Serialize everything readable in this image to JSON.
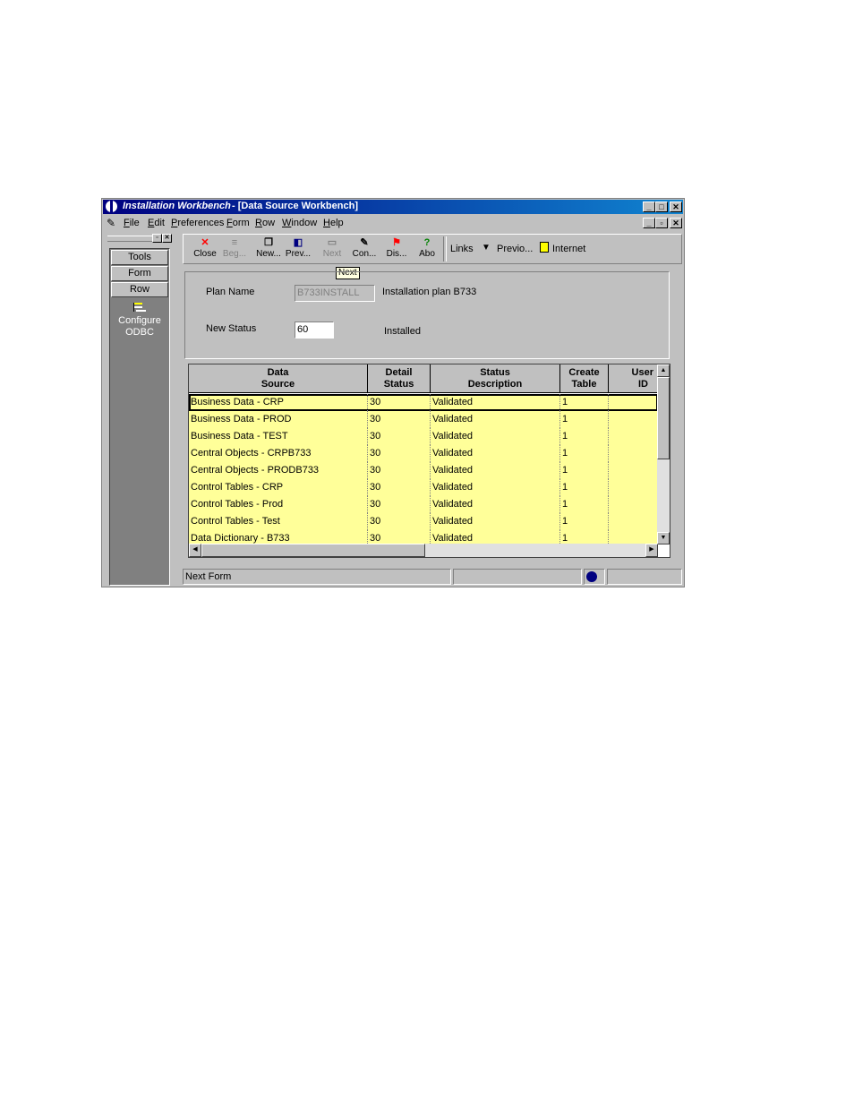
{
  "window": {
    "title_app": "Installation Workbench",
    "title_rest": " - [Data Source Workbench]",
    "controls": {
      "minimize": "_",
      "maximize": "□",
      "close": "✕",
      "restore": "▫"
    }
  },
  "menu": {
    "items": [
      "File",
      "Edit",
      "Preferences",
      "Form",
      "Row",
      "Window",
      "Help"
    ]
  },
  "sidebar": {
    "buttons": [
      "Tools",
      "Form",
      "Row"
    ],
    "exit_label_line1": "Configure",
    "exit_label_line2": "ODBC"
  },
  "toolbar": {
    "buttons": [
      {
        "label": "Close",
        "icon": "close-icon",
        "glyph": "✕",
        "color": "#ff0000",
        "enabled": true
      },
      {
        "label": "Beg...",
        "icon": "begin-icon",
        "glyph": "≡",
        "color": "#808080",
        "enabled": false
      },
      {
        "label": "New...",
        "icon": "new-icon",
        "glyph": "❐",
        "color": "#000000",
        "enabled": true
      },
      {
        "label": "Prev...",
        "icon": "previous-icon",
        "glyph": "◧",
        "color": "#000080",
        "enabled": true
      },
      {
        "label": "Next",
        "icon": "next-icon",
        "glyph": "▭",
        "color": "#808080",
        "enabled": false
      },
      {
        "label": "Con...",
        "icon": "connect-icon",
        "glyph": "✎",
        "color": "#000000",
        "enabled": true
      },
      {
        "label": "Dis...",
        "icon": "display-icon",
        "glyph": "⚑",
        "color": "#ff0000",
        "enabled": true
      },
      {
        "label": "Abo",
        "icon": "about-icon",
        "glyph": "?",
        "color": "#008000",
        "enabled": true
      }
    ],
    "links_label": "Links",
    "previous_label": "Previo...",
    "internet_label": "Internet",
    "tooltip": "Next"
  },
  "form": {
    "plan_name_label": "Plan Name",
    "plan_name_value": "B733INSTALL",
    "plan_description": "Installation plan B733",
    "new_status_label": "New Status",
    "new_status_value": "60",
    "new_status_description": "Installed"
  },
  "grid": {
    "columns": [
      {
        "line1": "Data",
        "line2": "Source"
      },
      {
        "line1": "Detail",
        "line2": "Status"
      },
      {
        "line1": "Status",
        "line2": "Description"
      },
      {
        "line1": "Create",
        "line2": "Table"
      },
      {
        "line1": "User",
        "line2": "ID"
      }
    ],
    "rows": [
      [
        "Business Data - CRP",
        "30",
        "Validated",
        "1",
        ""
      ],
      [
        "Business Data - PROD",
        "30",
        "Validated",
        "1",
        ""
      ],
      [
        "Business Data - TEST",
        "30",
        "Validated",
        "1",
        ""
      ],
      [
        "Central Objects - CRPB733",
        "30",
        "Validated",
        "1",
        ""
      ],
      [
        "Central Objects - PRODB733",
        "30",
        "Validated",
        "1",
        ""
      ],
      [
        "Control Tables - CRP",
        "30",
        "Validated",
        "1",
        ""
      ],
      [
        "Control Tables - Prod",
        "30",
        "Validated",
        "1",
        ""
      ],
      [
        "Control Tables - Test",
        "30",
        "Validated",
        "1",
        ""
      ],
      [
        "Data Dictionary - B733",
        "30",
        "Validated",
        "1",
        ""
      ]
    ],
    "selected_row": 0,
    "row_color": "#ffff99"
  },
  "status": {
    "text": "Next Form",
    "globe_icon": "globe-icon"
  }
}
